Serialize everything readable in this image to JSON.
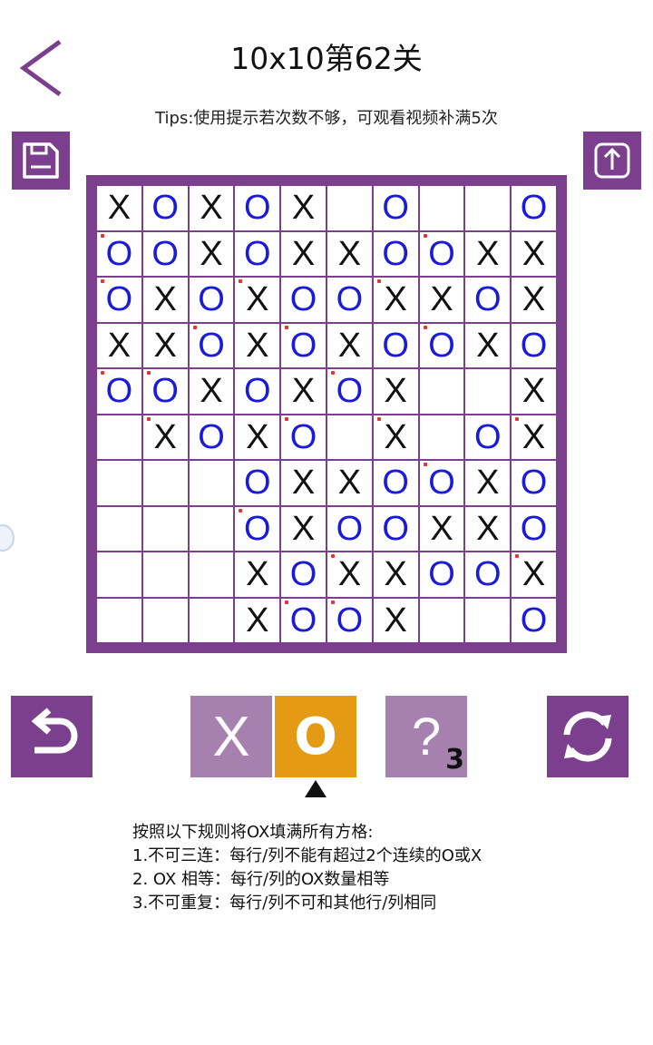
{
  "header": {
    "title": "10x10第62关",
    "tips": "Tips:使用提示若次数不够，可观看视频补满5次"
  },
  "icons": {
    "back": "chevron-left-icon",
    "save": "save-icon",
    "share": "share-upload-icon",
    "undo": "undo-arrow-icon",
    "refresh": "refresh-icon"
  },
  "colors": {
    "accent": "#7b3f8e",
    "piece_x": "#111111",
    "piece_o": "#1a1adb",
    "selected": "#e49b13",
    "inactive_tool": "#a681b0",
    "clue_mark": "#e5342a"
  },
  "board": {
    "size": 10,
    "rows": [
      [
        "X",
        "O",
        "X",
        "O",
        "X",
        "",
        "O",
        "",
        "",
        "O"
      ],
      [
        "O",
        "O",
        "X",
        "O",
        "X",
        "X",
        "O",
        "O",
        "X",
        "X"
      ],
      [
        "O",
        "X",
        "O",
        "X",
        "O",
        "O",
        "X",
        "X",
        "O",
        "X"
      ],
      [
        "X",
        "X",
        "O",
        "X",
        "O",
        "X",
        "O",
        "O",
        "X",
        "O"
      ],
      [
        "O",
        "O",
        "X",
        "O",
        "X",
        "O",
        "X",
        "",
        "",
        "X"
      ],
      [
        "",
        "X",
        "O",
        "X",
        "O",
        "",
        "X",
        "",
        "O",
        "X"
      ],
      [
        "",
        "",
        "",
        "O",
        "X",
        "X",
        "O",
        "O",
        "X",
        "O"
      ],
      [
        "",
        "",
        "",
        "O",
        "X",
        "O",
        "O",
        "X",
        "X",
        "O"
      ],
      [
        "",
        "",
        "",
        "X",
        "O",
        "X",
        "X",
        "O",
        "O",
        "X"
      ],
      [
        "",
        "",
        "",
        "X",
        "O",
        "O",
        "X",
        "",
        "",
        "O"
      ]
    ],
    "marked": [
      [
        0,
        0,
        0,
        0,
        0,
        0,
        0,
        0,
        0,
        0
      ],
      [
        1,
        0,
        0,
        0,
        0,
        0,
        0,
        1,
        0,
        0
      ],
      [
        1,
        0,
        0,
        1,
        0,
        0,
        1,
        0,
        0,
        0
      ],
      [
        0,
        0,
        1,
        0,
        1,
        0,
        0,
        1,
        0,
        0
      ],
      [
        1,
        1,
        0,
        0,
        0,
        1,
        0,
        0,
        0,
        0
      ],
      [
        0,
        1,
        0,
        0,
        1,
        0,
        1,
        0,
        0,
        1
      ],
      [
        0,
        0,
        0,
        0,
        0,
        0,
        0,
        1,
        0,
        0
      ],
      [
        0,
        0,
        0,
        1,
        0,
        0,
        0,
        0,
        0,
        0
      ],
      [
        0,
        0,
        0,
        0,
        0,
        1,
        0,
        0,
        0,
        1
      ],
      [
        0,
        0,
        0,
        0,
        1,
        1,
        0,
        0,
        0,
        0
      ]
    ]
  },
  "tools": {
    "x_label": "X",
    "o_label": "O",
    "selected": "O",
    "hint_label": "?",
    "hint_count": "3"
  },
  "rules": [
    "按照以下规则将OX填满所有方格:",
    "1.不可三连：每行/列不能有超过2个连续的O或X",
    "2. OX 相等：每行/列的OX数量相等",
    "3.不可重复：每行/列不可和其他行/列相同"
  ]
}
